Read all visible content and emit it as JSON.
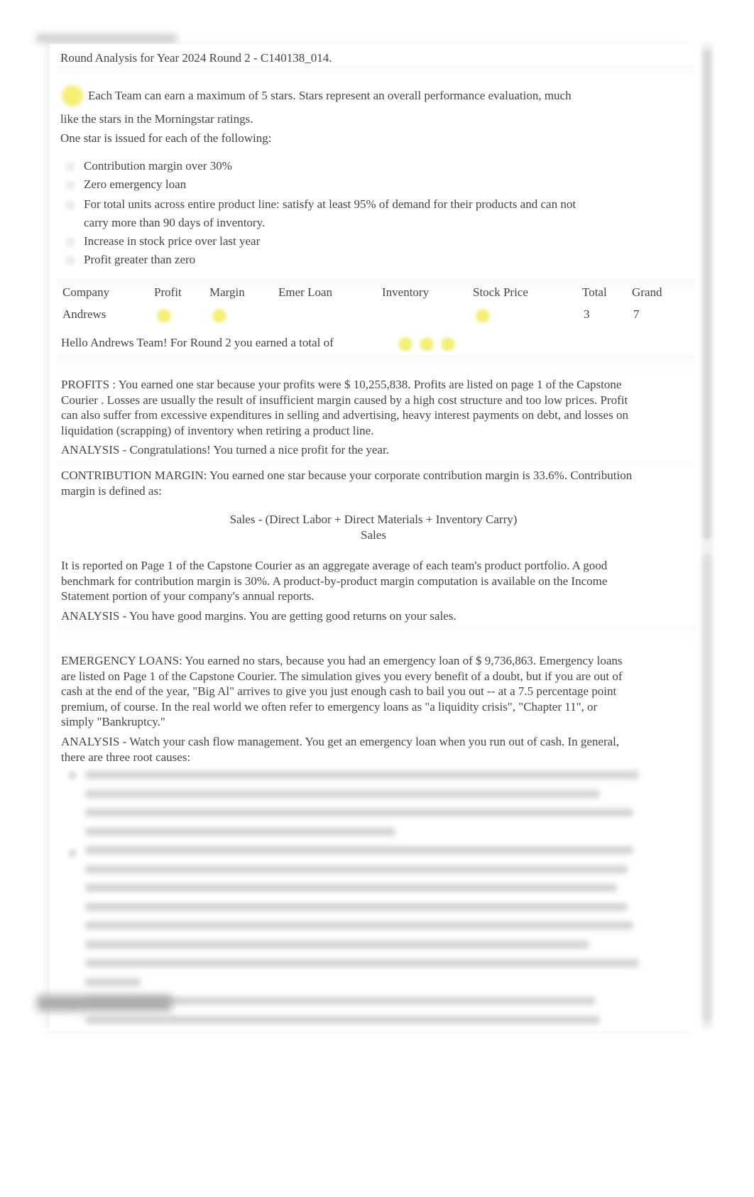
{
  "header": {
    "title": "Round Analysis for Year 2024 Round 2 - C140138_014."
  },
  "intro": {
    "line1": "Each Team can earn a maximum of 5 stars. Stars represent an overall performance evaluation, much",
    "line2": "like the stars in the Morningstar ratings.",
    "line3": "One star is issued for each of the following:"
  },
  "criteria": [
    {
      "line1": "Contribution margin over 30%"
    },
    {
      "line1": "Zero emergency loan"
    },
    {
      "line1": "For total units across entire product line: satisfy at least 95% of demand for their products and can not",
      "line2": "carry more than 90 days of inventory."
    },
    {
      "line1": "Increase in stock price over last year"
    },
    {
      "line1": "Profit greater than zero"
    }
  ],
  "stars_table": {
    "headers": [
      "Company",
      "Profit",
      "Margin",
      "Emer Loan",
      "Inventory",
      "Stock Price",
      "Total",
      "Grand"
    ],
    "rows": [
      {
        "company": "Andrews",
        "profit_star": true,
        "margin_star": true,
        "emer_loan_star": false,
        "inventory_star": false,
        "stock_price_star": true,
        "total": "3",
        "grand": "7"
      }
    ]
  },
  "greeting": {
    "text": "Hello Andrews Team! For Round 2 you earned a total of",
    "stars_earned": 3
  },
  "sections": {
    "profits": {
      "body": "PROFITS :   You earned one star because your profits were $ 10,255,838. Profits are listed on page 1 of the Capstone Courier . Losses are usually the result of insufficient margin caused by a high cost structure and too low prices. Profit can also suffer from excessive expenditures in selling and advertising, heavy interest payments on debt, and losses on liquidation (scrapping) of inventory when retiring a product line.",
      "analysis": "ANALYSIS  - Congratulations! You turned a nice profit for the year."
    },
    "contribution_margin": {
      "body": "CONTRIBUTION MARGIN:  You earned one star because your corporate contribution margin is 33.6%. Contribution margin is defined as:",
      "formula_numerator": "Sales - (Direct Labor + Direct Materials + Inventory Carry)",
      "formula_denominator": "Sales",
      "body2": "It is reported on Page 1 of the Capstone Courier as an aggregate average of each team's product portfolio. A good benchmark for contribution margin is 30%. A product-by-product margin computation is available on the Income Statement portion of your company's annual reports.",
      "analysis": "ANALYSIS  - You have good margins. You are getting good returns on your sales."
    },
    "emergency_loans": {
      "body": "EMERGENCY LOANS:   You earned no stars, because you had an emergency loan of $ 9,736,863. Emergency loans are listed on Page 1 of the Capstone Courier. The simulation gives you every benefit of a doubt, but if you are out of cash at the end of the year, \"Big Al\" arrives to give you just enough cash to bail you out -- at a 7.5 percentage point premium, of course. In the real world we often refer to emergency loans as \"a liquidity crisis\", \"Chapter 11\", or simply \"Bankruptcy.\"",
      "analysis": "ANALYSIS  - Watch your cash flow management. You get an emergency loan when you run out of cash. In general, there are three root causes:"
    }
  },
  "colors": {
    "star": "#f4f06a",
    "text": "#444444"
  }
}
